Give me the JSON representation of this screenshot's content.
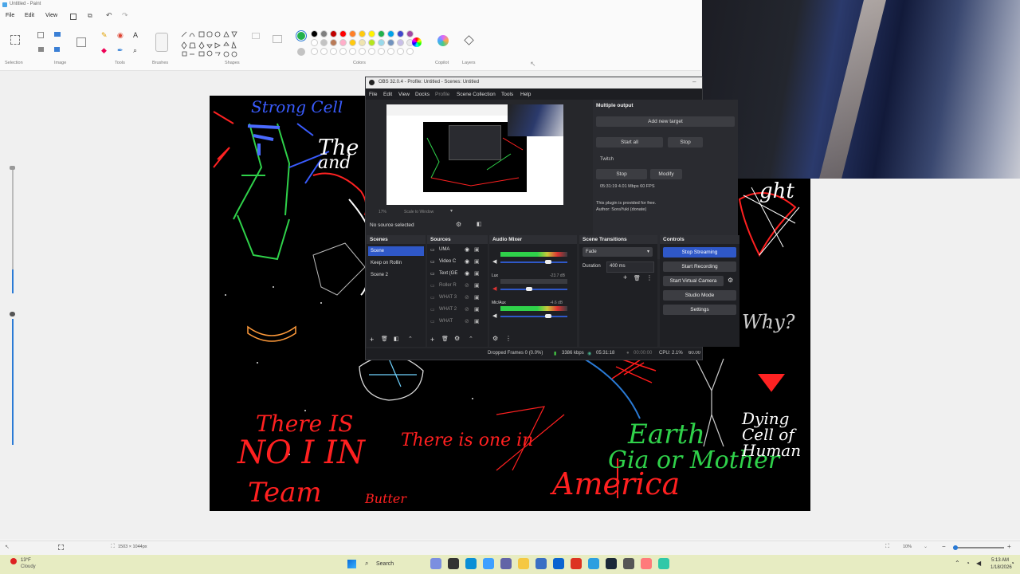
{
  "paint": {
    "title": "Untitled - Paint",
    "menu": [
      "File",
      "Edit",
      "View"
    ],
    "ribbon_groups": [
      "Selection",
      "Image",
      "Tools",
      "Brushes",
      "Shapes",
      "Colors",
      "Copilot",
      "Layers"
    ],
    "status": {
      "canvas_size": "1503 × 1044px",
      "zoom": "10%"
    }
  },
  "colors": {
    "row1": [
      "#000000",
      "#7f7f7f",
      "#c00000",
      "#ff0000",
      "#ff7f27",
      "#ffc90e",
      "#fff200",
      "#22b14c",
      "#00a2e8",
      "#3f48cc",
      "#a349a4"
    ],
    "row2": [
      "#ffffff",
      "#c3c3c3",
      "#b97a57",
      "#ffaec9",
      "#ffc90e",
      "#efe4b0",
      "#b5e61d",
      "#99d9ea",
      "#7092be",
      "#c8bfe7",
      "#e8e8e8"
    ],
    "primary": "#22b14c",
    "secondary": "#c3c3c3"
  },
  "drawing_text": {
    "t1": "There IS",
    "t2": "NO I IN",
    "t3": "Team",
    "t4": "Butter",
    "t5": "There is one in",
    "t6": "America",
    "t7": "Earth",
    "t8": "Gia or Mother",
    "t9": "Dying Cell of Human",
    "t10": "The",
    "t11": "and",
    "t12": "Why?",
    "t13": "ght",
    "t14": "Strong Cell"
  },
  "obs": {
    "title": "OBS 32.0.4 - Profile: Untitled - Scenes: Untitled",
    "menu": [
      "File",
      "Edit",
      "View",
      "Docks",
      "Profile",
      "Scene Collection",
      "Tools",
      "Help"
    ],
    "preview_zoom": "17%",
    "scale_mode": "Scale to Window",
    "no_source": "No source selected",
    "multiple_output": {
      "title": "Multiple output",
      "add_target": "Add new target",
      "start_all": "Start all",
      "stop_all": "Stop",
      "service": "Twitch",
      "stop": "Stop",
      "modify": "Modify",
      "stats": "05:31:19  4.01 Mbps  60 FPS",
      "free_note": "This plugin is provided for free.",
      "author": "Author: SoraYuki (donate)"
    },
    "scenes": {
      "header": "Scenes",
      "items": [
        "Scene",
        "Keep on Rollin",
        "Scene 2"
      ]
    },
    "sources": {
      "header": "Sources",
      "items": [
        "UMA",
        "Video C",
        "Text (GE",
        "Roller R",
        "WHAT 3",
        "WHAT 2",
        "WHAT"
      ]
    },
    "audio": {
      "header": "Audio Mixer",
      "channels": [
        {
          "name": "",
          "db": ""
        },
        {
          "name": "Lux",
          "db": "-23.7 dB"
        },
        {
          "name": "Mic/Aux",
          "db": "-4.6 dB"
        }
      ]
    },
    "transitions": {
      "header": "Scene Transitions",
      "type": "Fade",
      "duration_label": "Duration",
      "duration": "400 ms"
    },
    "controls": {
      "header": "Controls",
      "stop_streaming": "Stop Streaming",
      "start_recording": "Start Recording",
      "start_virtual_camera": "Start Virtual Camera",
      "studio_mode": "Studio Mode",
      "settings": "Settings"
    },
    "status": {
      "dropped": "Dropped Frames 0 (0.0%)",
      "bitrate": "3386 kbps",
      "stream_time": "05:31:18",
      "rec_time": "00:00:00",
      "cpu": "CPU: 2.1%",
      "fps": "60.00 / 60.00 FPS"
    }
  },
  "taskbar": {
    "weather_temp": "13°F",
    "weather_desc": "Cloudy",
    "search": "Search",
    "time": "5:13 AM",
    "date": "1/18/2026"
  }
}
